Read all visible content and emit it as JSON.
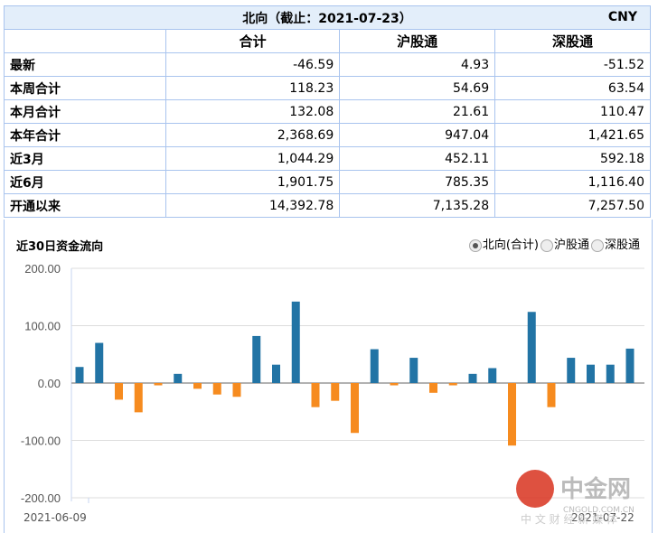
{
  "table": {
    "title": "北向（截止：2021-07-23）",
    "currency": "CNY",
    "headers": [
      "合计",
      "沪股通",
      "深股通"
    ],
    "rows": [
      {
        "label": "最新",
        "values": [
          "-46.59",
          "4.93",
          "-51.52"
        ]
      },
      {
        "label": "本周合计",
        "values": [
          "118.23",
          "54.69",
          "63.54"
        ]
      },
      {
        "label": "本月合计",
        "values": [
          "132.08",
          "21.61",
          "110.47"
        ]
      },
      {
        "label": "本年合计",
        "values": [
          "2,368.69",
          "947.04",
          "1,421.65"
        ]
      },
      {
        "label": "近3月",
        "values": [
          "1,044.29",
          "452.11",
          "592.18"
        ]
      },
      {
        "label": "近6月",
        "values": [
          "1,901.75",
          "785.35",
          "1,116.40"
        ]
      },
      {
        "label": "开通以来",
        "values": [
          "14,392.78",
          "7,135.28",
          "7,257.50"
        ]
      }
    ]
  },
  "chart_data": {
    "type": "bar",
    "title": "近30日资金流向",
    "options": [
      "北向(合计)",
      "沪股通",
      "深股通"
    ],
    "selected": "北向(合计)",
    "ylim": [
      -200,
      200
    ],
    "yticks": [
      "200.00",
      "100.00",
      "0.00",
      "-100.00",
      "-200.00"
    ],
    "x_first": "2021-06-09",
    "x_last": "2021-07-22",
    "values": [
      28,
      70,
      -29,
      -51,
      -4,
      16,
      -10,
      -20,
      -24,
      82,
      32,
      142,
      -42,
      -31,
      -87,
      59,
      -4,
      44,
      -17,
      -4,
      16,
      26,
      -109,
      124,
      -42,
      44,
      32,
      32,
      60
    ],
    "colors": {
      "positive": "#2274a5",
      "negative": "#f68b1f"
    }
  },
  "watermark": {
    "name": "中金网",
    "domain": "CNGOLD.COM.CN",
    "slogan": "中 文 财 经 新 媒 体"
  }
}
